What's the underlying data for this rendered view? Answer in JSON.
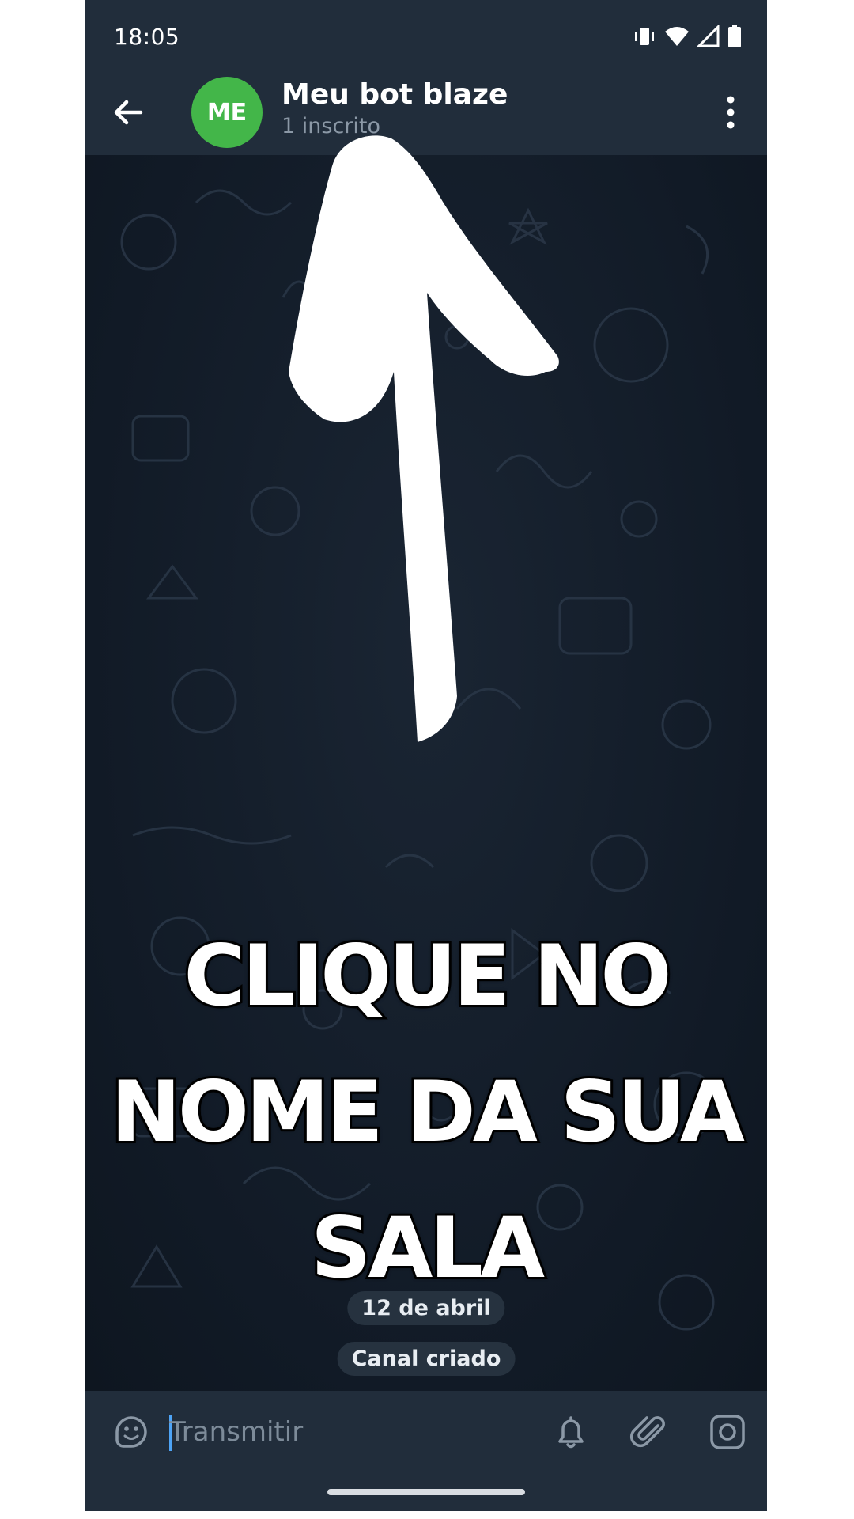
{
  "status_bar": {
    "time": "18:05",
    "icons": [
      "vibrate-icon",
      "wifi-icon",
      "signal-icon",
      "battery-icon"
    ]
  },
  "header": {
    "avatar_initials": "ME",
    "avatar_color": "#43b649",
    "title": "Meu bot blaze",
    "subtitle": "1 inscrito",
    "icons": [
      "back-arrow-icon",
      "more-vertical-icon"
    ]
  },
  "chat": {
    "date_label": "12 de abril",
    "service_message": "Canal criado"
  },
  "input_bar": {
    "placeholder": "Transmitir",
    "value": "",
    "icons": [
      "sticker-icon",
      "bell-icon",
      "paperclip-icon",
      "camera-icon"
    ]
  },
  "overlay": {
    "instruction": "CLIQUE NO NOME DA SUA SALA",
    "arrow": "arrow-up-icon"
  },
  "colors": {
    "bar_background": "#212d3b",
    "chat_background": "#111a26",
    "accent": "#4ea4f6"
  }
}
